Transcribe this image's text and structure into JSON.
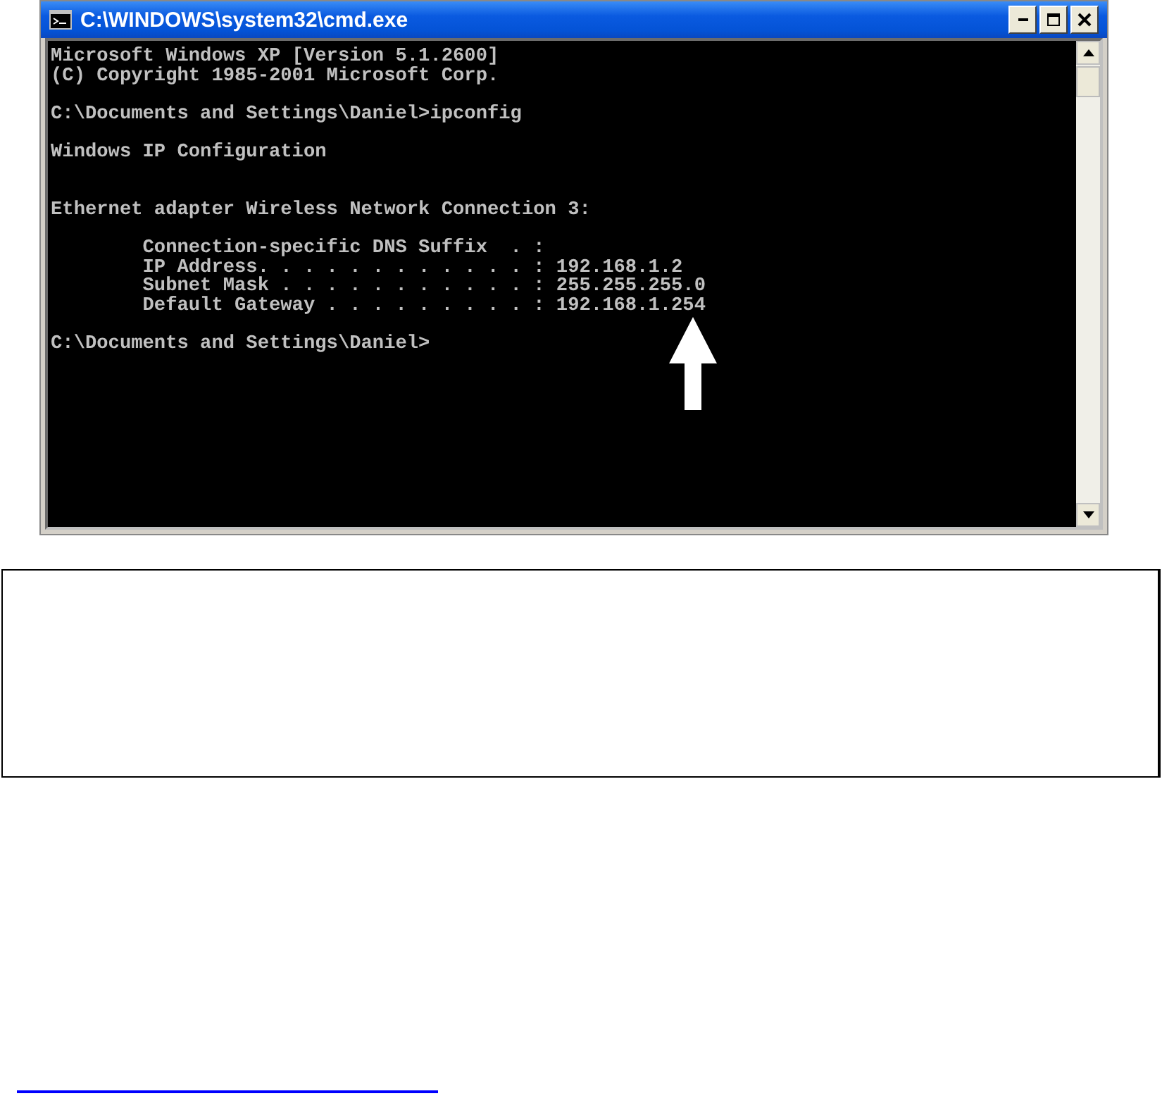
{
  "window": {
    "title": "C:\\WINDOWS\\system32\\cmd.exe"
  },
  "console": {
    "groups": [
      {
        "lines": [
          "Microsoft Windows XP [Version 5.1.2600]",
          "(C) Copyright 1985-2001 Microsoft Corp."
        ]
      },
      {
        "lines": [
          "C:\\Documents and Settings\\Daniel>ipconfig"
        ]
      },
      {
        "lines": [
          "Windows IP Configuration"
        ]
      },
      {
        "lines": [
          "Ethernet adapter Wireless Network Connection 3:"
        ]
      },
      {
        "lines": [
          "        Connection-specific DNS Suffix  . :",
          "        IP Address. . . . . . . . . . . . : 192.168.1.2",
          "        Subnet Mask . . . . . . . . . . . : 255.255.255.0",
          "        Default Gateway . . . . . . . . . : 192.168.1.254"
        ]
      },
      {
        "lines": [
          "C:\\Documents and Settings\\Daniel>"
        ]
      }
    ]
  }
}
